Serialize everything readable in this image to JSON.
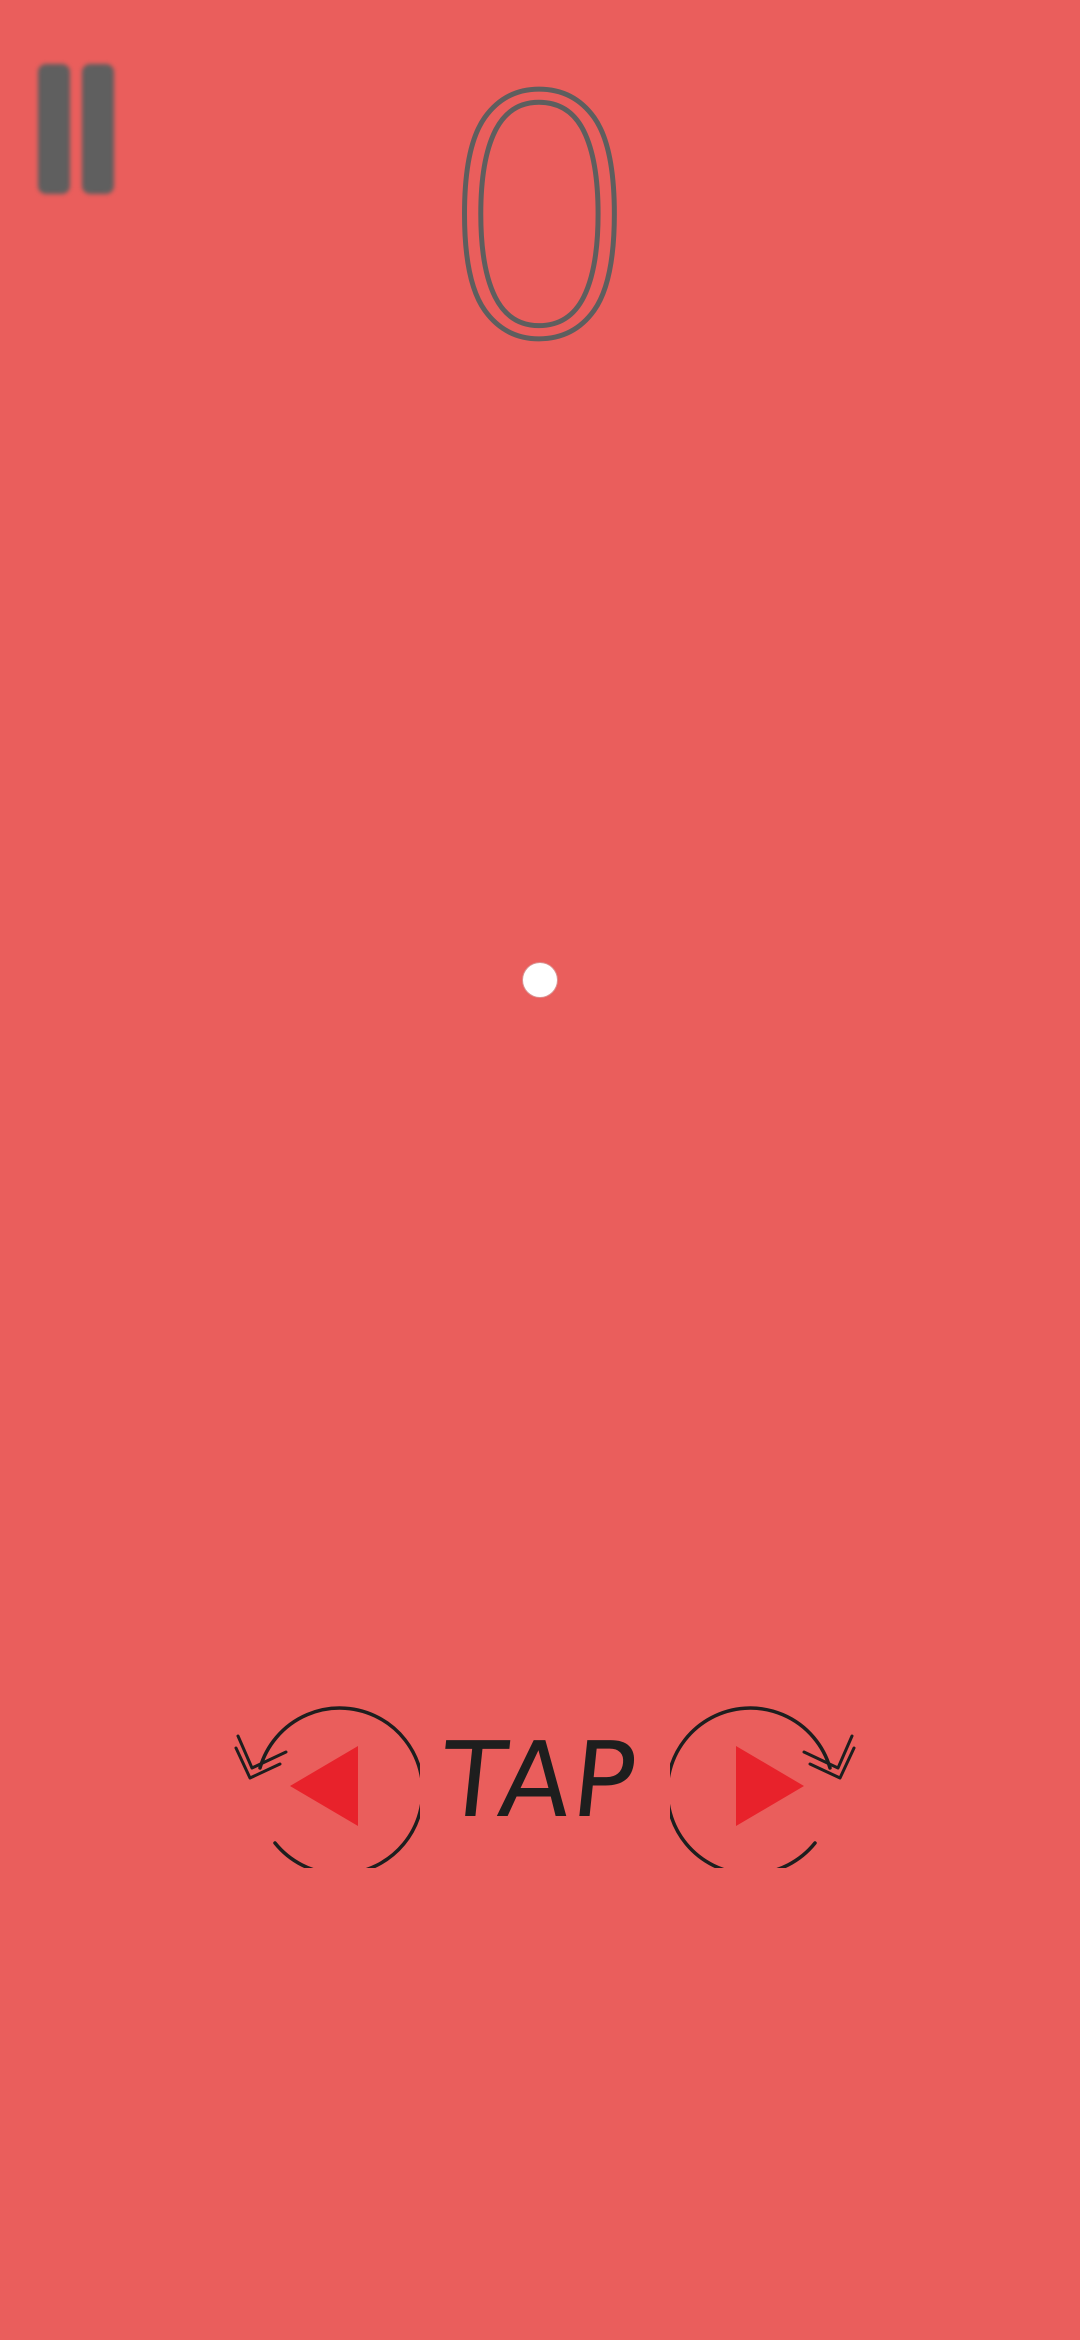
{
  "game": {
    "score": "0",
    "tap_hint": "TAP"
  },
  "icons": {
    "pause": "pause-icon",
    "rotate_left": "rotate-left-arrow-icon",
    "rotate_right": "rotate-right-arrow-icon",
    "ball": "ball"
  },
  "colors": {
    "background": "#EA5E5C",
    "score_stroke": "#5E5E5E",
    "pause_bars": "#5F5F5F",
    "arrow_fill": "#E8222B",
    "hint_ink": "#1E1E1E",
    "ball": "#FFFFFF"
  }
}
